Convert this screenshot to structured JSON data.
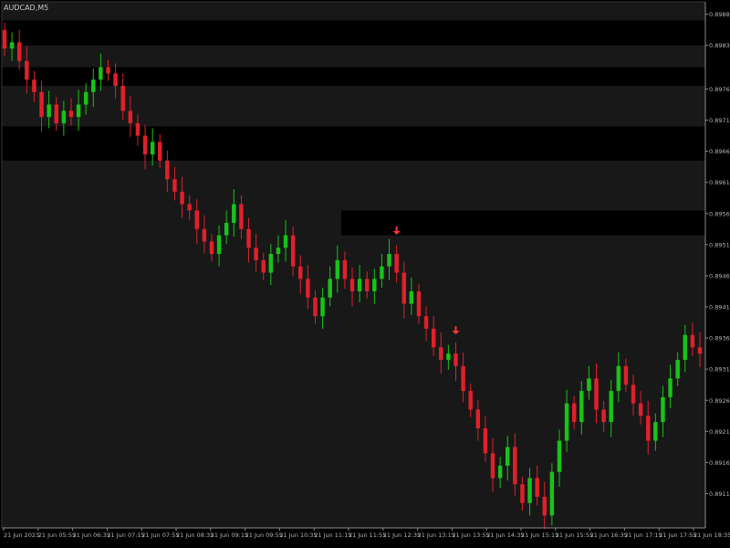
{
  "window": {
    "symbol_label": "AUDCAD,M5"
  },
  "colors": {
    "background": "#181818",
    "zone": "#000000",
    "bull": "#19c219",
    "bear": "#e0202a",
    "signal_arrow": "#ff3535",
    "axis": "#8a8a8a",
    "text": "#b4b4b4"
  },
  "chart_data": {
    "type": "candlestick",
    "instrument": "AUDCAD",
    "timeframe": "M5",
    "ylim": [
      0.8906,
      0.89905
    ],
    "y_ticks": [
      "0.89885",
      "0.89835",
      "0.89765",
      "0.89715",
      "0.89665",
      "0.89615",
      "0.89565",
      "0.89515",
      "0.89465",
      "0.89415",
      "0.89365",
      "0.89315",
      "0.89265",
      "0.89215",
      "0.89165",
      "0.89115"
    ],
    "x_ticks": [
      "21 Jun 2023",
      "21 Jun 05:55",
      "21 Jun 06:35",
      "21 Jun 07:15",
      "21 Jun 07:55",
      "21 Jun 08:35",
      "21 Jun 09:15",
      "21 Jun 09:55",
      "21 Jun 10:35",
      "21 Jun 11:15",
      "21 Jun 11:55",
      "21 Jun 12:35",
      "21 Jun 13:15",
      "21 Jun 13:55",
      "21 Jun 14:35",
      "21 Jun 15:15",
      "21 Jun 15:55",
      "21 Jun 16:35",
      "21 Jun 17:15",
      "21 Jun 17:55",
      "21 Jun 18:35"
    ],
    "closes": [
      0.8983,
      0.8984,
      0.8981,
      0.8978,
      0.8976,
      0.8972,
      0.8974,
      0.8971,
      0.8973,
      0.8972,
      0.8974,
      0.8976,
      0.8978,
      0.898,
      0.8979,
      0.8977,
      0.8973,
      0.8971,
      0.8969,
      0.8966,
      0.8968,
      0.8965,
      0.8962,
      0.896,
      0.8958,
      0.8957,
      0.8954,
      0.8952,
      0.895,
      0.8953,
      0.8955,
      0.8958,
      0.8954,
      0.8951,
      0.8949,
      0.8947,
      0.895,
      0.8951,
      0.8953,
      0.8948,
      0.8946,
      0.8943,
      0.894,
      0.8943,
      0.8946,
      0.8949,
      0.8946,
      0.8944,
      0.8946,
      0.8944,
      0.8946,
      0.8948,
      0.895,
      0.8947,
      0.8942,
      0.8944,
      0.894,
      0.8938,
      0.8935,
      0.8933,
      0.8934,
      0.8932,
      0.8928,
      0.8925,
      0.8922,
      0.8918,
      0.8914,
      0.8916,
      0.8919,
      0.8913,
      0.891,
      0.8914,
      0.8911,
      0.8908,
      0.8915,
      0.892,
      0.8926,
      0.8923,
      0.8928,
      0.893,
      0.8925,
      0.8923,
      0.8928,
      0.8932,
      0.8929,
      0.8926,
      0.8924,
      0.892,
      0.8923,
      0.8927,
      0.893,
      0.8933,
      0.8937,
      0.8935,
      0.8934
    ],
    "first_open": 0.8986,
    "supply_demand_zones": [
      {
        "from": 0.8977,
        "to": 0.898,
        "start_index": 0
      },
      {
        "from": 0.89835,
        "to": 0.89875,
        "start_index": 0
      },
      {
        "from": 0.8965,
        "to": 0.89705,
        "start_index": 0
      },
      {
        "from": 0.8953,
        "to": 0.8957,
        "start_index": 46
      }
    ],
    "signal_arrows": [
      {
        "index": 53,
        "direction": "down"
      },
      {
        "index": 61,
        "direction": "down"
      }
    ]
  }
}
